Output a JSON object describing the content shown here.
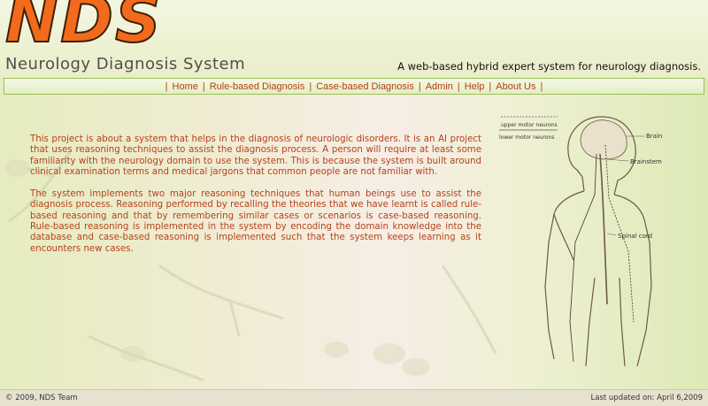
{
  "header": {
    "logo": "NDS",
    "subtitle": "Neurology Diagnosis System",
    "tagline": "A web-based hybrid expert system for neurology diagnosis."
  },
  "nav": {
    "items": [
      {
        "label": "Home"
      },
      {
        "label": "Rule-based Diagnosis"
      },
      {
        "label": "Case-based Diagnosis"
      },
      {
        "label": "Admin"
      },
      {
        "label": "Help"
      },
      {
        "label": "About Us"
      }
    ]
  },
  "content": {
    "paragraph1": "This project is about a system that helps in the diagnosis of neurologic disorders. It is an AI project that uses reasoning techniques to assist the diagnosis process. A person will require at least some familiarity with the neurology domain to use the system. This is because the system is built around clinical examination terms and medical jargons that common people are not familiar with.",
    "paragraph2": "The system implements two major reasoning techniques that human beings use to assist the diagnosis process. Reasoning performed by recalling the theories that we have learnt is called rule-based reasoning and that by remembering similar cases or scenarios is case-based reasoning. Rule-based reasoning is implemented in the system by encoding the domain knowledge into the database and case-based reasoning is implemented such that the system keeps learning as it encounters new cases."
  },
  "illustration": {
    "legend_upper": "upper motor neurons",
    "legend_lower": "lower motor neurons",
    "label_brain": "Brain",
    "label_brainstem": "Brainstem",
    "label_spinal": "Spinal cord"
  },
  "footer": {
    "copyright": "© 2009, NDS Team",
    "updated": "Last updated on: April 6,2009"
  },
  "colors": {
    "accent": "#f26a1b",
    "text": "#b8401c",
    "nav_border": "#9bbf5a"
  }
}
